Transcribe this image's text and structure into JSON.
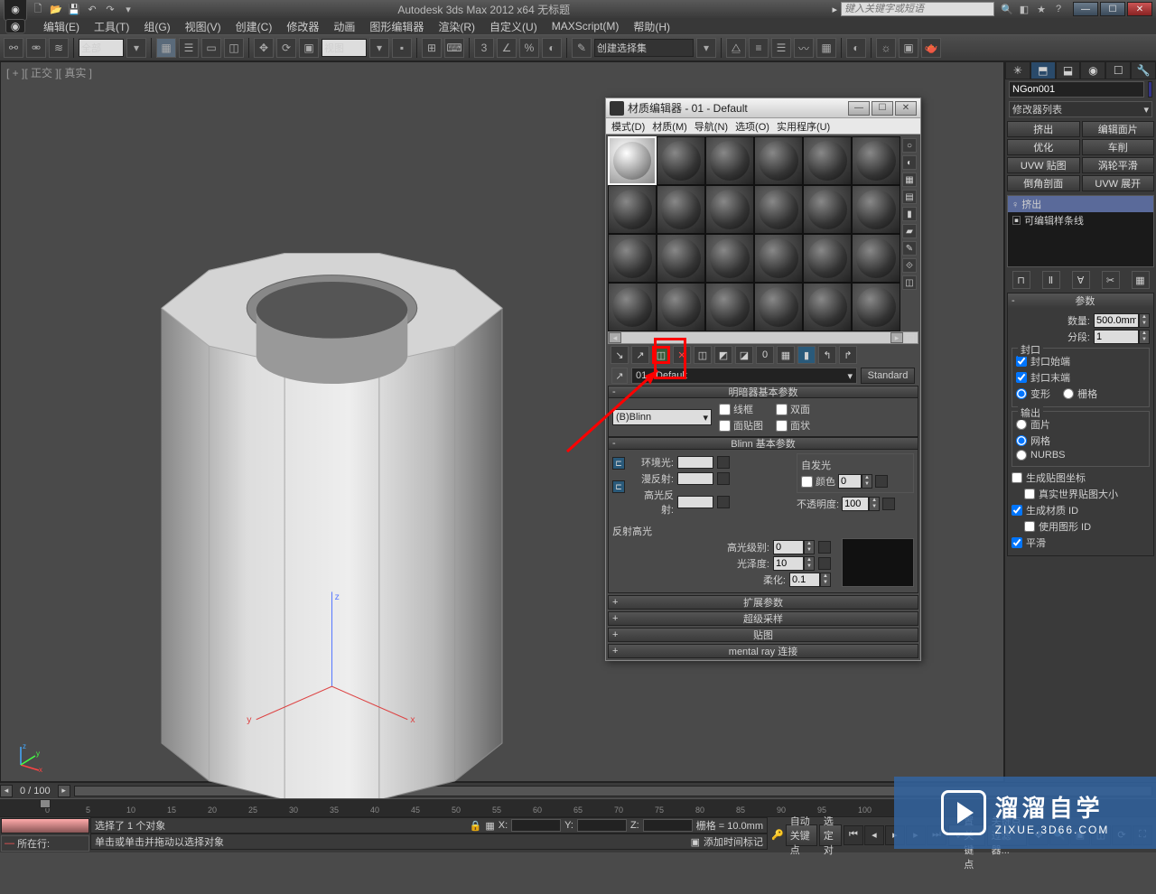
{
  "app": {
    "title": "Autodesk 3ds Max  2012 x64    无标题",
    "search_placeholder": "键入关键字或短语"
  },
  "menu": [
    "编辑(E)",
    "工具(T)",
    "组(G)",
    "视图(V)",
    "创建(C)",
    "修改器",
    "动画",
    "图形编辑器",
    "渲染(R)",
    "自定义(U)",
    "MAXScript(M)",
    "帮助(H)"
  ],
  "toolbar": {
    "sel_filter": "全部",
    "view_combo": "视图",
    "named_sel": "创建选择集"
  },
  "viewport": {
    "label": "[ + ][ 正交 ][ 真实 ]"
  },
  "right_panel": {
    "object_name": "NGon001",
    "mod_list_label": "修改器列表",
    "buttons": [
      "挤出",
      "编辑面片",
      "优化",
      "车削",
      "UVW 贴图",
      "涡轮平滑",
      "倒角剖面",
      "UVW 展开"
    ],
    "stack": [
      "挤出",
      "可编辑样条线"
    ],
    "param_title": "参数",
    "amount_label": "数量:",
    "amount_value": "500.0mm",
    "segs_label": "分段:",
    "segs_value": "1",
    "cap_group": "封口",
    "cap_start": "封口始端",
    "cap_end": "封口末端",
    "morph": "变形",
    "grid": "栅格",
    "output_group": "输出",
    "patch": "面片",
    "mesh": "网格",
    "nurbs": "NURBS",
    "gen_map": "生成贴图坐标",
    "real_world": "真实世界贴图大小",
    "gen_mat_id": "生成材质 ID",
    "use_shape_id": "使用图形 ID",
    "smooth": "平滑"
  },
  "mat_editor": {
    "title": "材质编辑器 - 01 - Default",
    "menu": [
      "模式(D)",
      "材质(M)",
      "导航(N)",
      "选项(O)",
      "实用程序(U)"
    ],
    "name": "01 - Default",
    "type": "Standard",
    "shader_rollout": "明暗器基本参数",
    "shader": "(B)Blinn",
    "wire": "线框",
    "two_sided": "双面",
    "face_map": "面贴图",
    "faceted": "面状",
    "blinn_rollout": "Blinn 基本参数",
    "ambient": "环境光:",
    "diffuse": "漫反射:",
    "specular": "高光反射:",
    "self_illum": "自发光",
    "self_color": "颜色",
    "self_value": "0",
    "opacity_label": "不透明度:",
    "opacity_value": "100",
    "spec_hl": "反射高光",
    "spec_level_label": "高光级别:",
    "spec_level_value": "0",
    "gloss_label": "光泽度:",
    "gloss_value": "10",
    "soften_label": "柔化:",
    "soften_value": "0.1",
    "rollouts": [
      "扩展参数",
      "超级采样",
      "贴图",
      "mental ray 连接"
    ]
  },
  "timeline": {
    "frame": "0 / 100"
  },
  "status": {
    "selected": "选择了 1 个对象",
    "hint": "单击或单击并拖动以选择对象",
    "script_label": "所在行:",
    "grid_label": "栅格 = 10.0mm",
    "auto_key": "自动关键点",
    "set_key": "设置关键点",
    "sel_set": "选定对",
    "key_filter": "关键点过滤器...",
    "add_time_tag": "添加时间标记"
  },
  "watermark": {
    "big": "溜溜自学",
    "small": "ZIXUE.3D66.COM"
  }
}
